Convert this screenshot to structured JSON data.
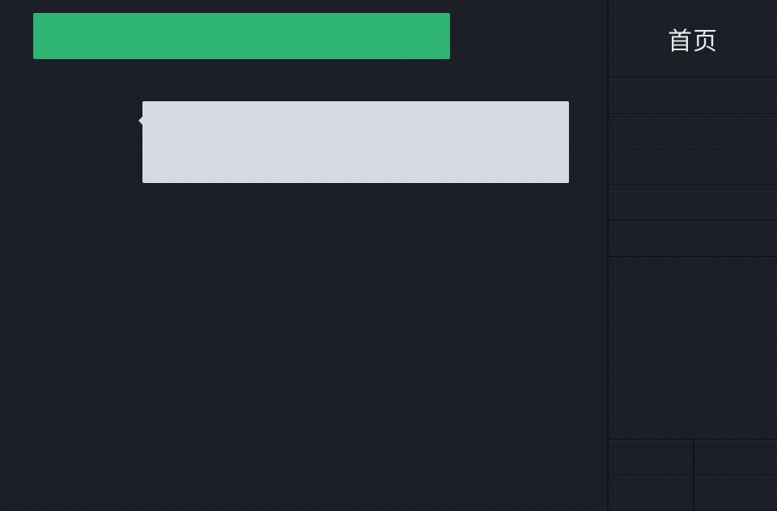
{
  "side_panel": {
    "title": "首页"
  },
  "colors": {
    "background": "#1a1f25",
    "accent_green": "#2eb574",
    "bubble": "#d5d9e0",
    "title_text": "#e8eaed"
  }
}
